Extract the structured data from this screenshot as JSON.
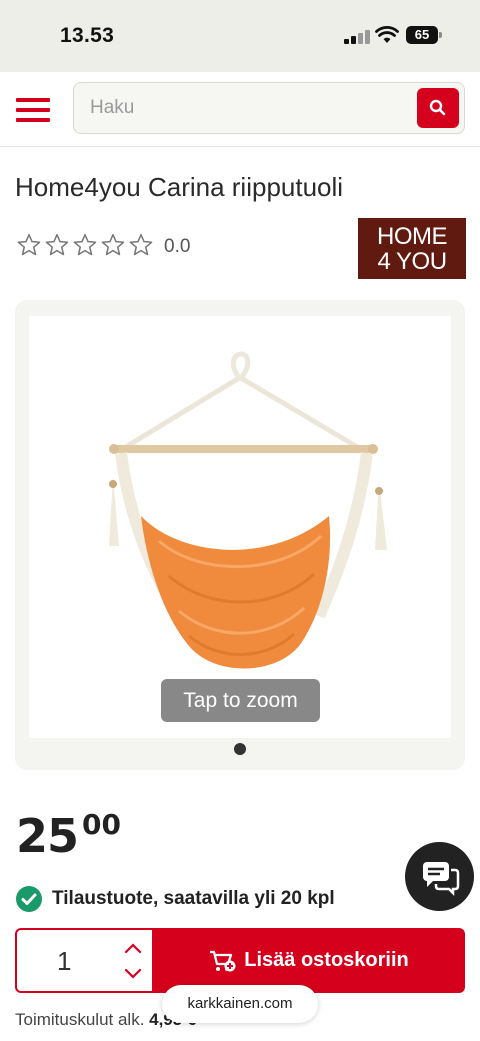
{
  "status_bar": {
    "time": "13.53",
    "battery": "65"
  },
  "header": {
    "search_placeholder": "Haku"
  },
  "product": {
    "title": "Home4you Carina riipputuoli",
    "rating": "0.0",
    "star_count": 5,
    "stars_filled": 0,
    "brand_logo": {
      "line1": "HOME",
      "line2": "4 YOU"
    },
    "zoom_hint": "Tap to zoom",
    "price_int": "25",
    "price_dec": "00",
    "availability": "Tilaustuote, saatavilla yli 20 kpl",
    "quantity": "1",
    "add_to_cart": "Lisää ostoskoriin",
    "shipping_label": "Toimituskulut alk.",
    "shipping_value": "4,95 €"
  },
  "browser": {
    "url": "karkkainen.com"
  },
  "colors": {
    "accent": "#d5001c",
    "brand_logo_bg": "#611a10",
    "in_stock": "#1a9a6b",
    "hammock": "#f08a3c"
  }
}
